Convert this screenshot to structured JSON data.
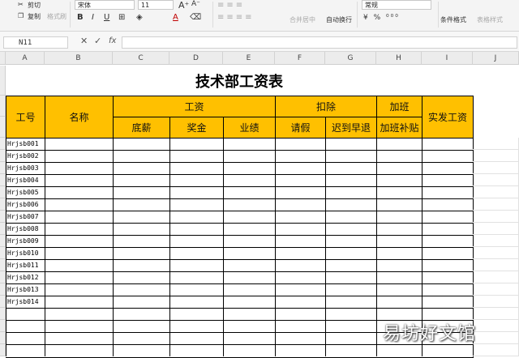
{
  "ribbon": {
    "cut": "剪切",
    "copy": "复制",
    "format_painter": "格式刷",
    "font_name": "宋体",
    "font_size": "11",
    "bold": "B",
    "italic": "I",
    "underline": "U",
    "font_color": "A",
    "merge_center": "合并居中",
    "wrap_text": "自动换行",
    "number_format": "常规",
    "conditional_format": "条件格式",
    "table_style": "表格样式"
  },
  "formula_bar": {
    "cell_ref": "N11",
    "fx": "fx",
    "cancel": "✕",
    "confirm": "✓"
  },
  "columns": [
    "A",
    "B",
    "C",
    "D",
    "E",
    "F",
    "G",
    "H",
    "I",
    "J"
  ],
  "sheet": {
    "title": "技术部工资表",
    "headers": {
      "id": "工号",
      "name": "名称",
      "salary": "工资",
      "base": "底薪",
      "bonus": "奖金",
      "performance": "业绩",
      "deduction": "扣除",
      "leave": "请假",
      "late": "迟到早退",
      "overtime": "加班",
      "overtime_pay": "加班补贴",
      "net_pay": "实发工资"
    },
    "ids": [
      "Hrjsb001",
      "Hrjsb002",
      "Hrjsb003",
      "Hrjsb004",
      "Hrjsb005",
      "Hrjsb006",
      "Hrjsb007",
      "Hrjsb008",
      "Hrjsb009",
      "Hrjsb010",
      "Hrjsb011",
      "Hrjsb012",
      "Hrjsb013",
      "Hrjsb014"
    ]
  },
  "watermark": "易坊好文馆",
  "colors": {
    "header_fill": "#ffc000"
  }
}
